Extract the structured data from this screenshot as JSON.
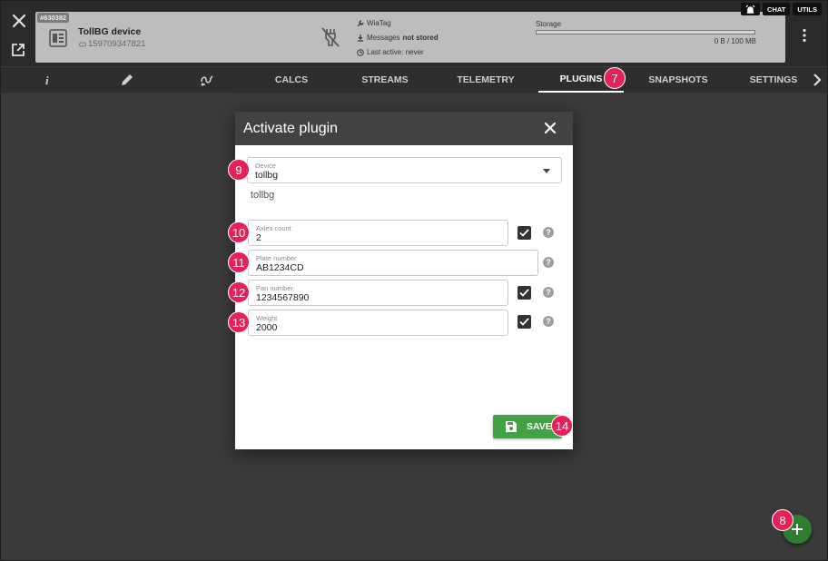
{
  "device": {
    "id_badge": "#630382",
    "name": "TollBG device",
    "phone": "159709347821",
    "protocol": "WiaTag",
    "messages_prefix": "Messages",
    "messages_state": "not stored",
    "last_active": "Last active: never",
    "storage_label": "Storage",
    "storage_value": "0 B / 100 MB",
    "storage_used_fraction": 0
  },
  "top_buttons": {
    "chat": "CHAT",
    "utils": "UTILS"
  },
  "tabs": {
    "calcs": "CALCS",
    "streams": "STREAMS",
    "telemetry": "TELEMETRY",
    "plugins": "PLUGINS",
    "snapshots": "SNAPSHOTS",
    "settings": "SETTINGS",
    "active": "PLUGINS"
  },
  "dialog": {
    "title": "Activate plugin",
    "device_field": {
      "label": "Device",
      "value": "tollbg"
    },
    "selected_text": "tollbg",
    "fields": [
      {
        "label": "Axles count",
        "value": "2",
        "checked": true
      },
      {
        "label": "Plate number",
        "value": "AB1234CD",
        "checked": false
      },
      {
        "label": "Pan number",
        "value": "1234567890",
        "checked": true
      },
      {
        "label": "Weight",
        "value": "2000",
        "checked": true
      }
    ],
    "help_glyph": "?",
    "save_label": "SAVE"
  },
  "annotations": {
    "plugins_tab": "7",
    "fab": "8",
    "device_select": "9",
    "axles": "10",
    "plate": "11",
    "pan": "12",
    "weight": "13",
    "save": "14"
  },
  "colors": {
    "background": "#3a3a3a",
    "header": "#2a2a2a",
    "badge": "#e5215a",
    "save_button": "#43a047",
    "fab": "#2e7d32"
  }
}
